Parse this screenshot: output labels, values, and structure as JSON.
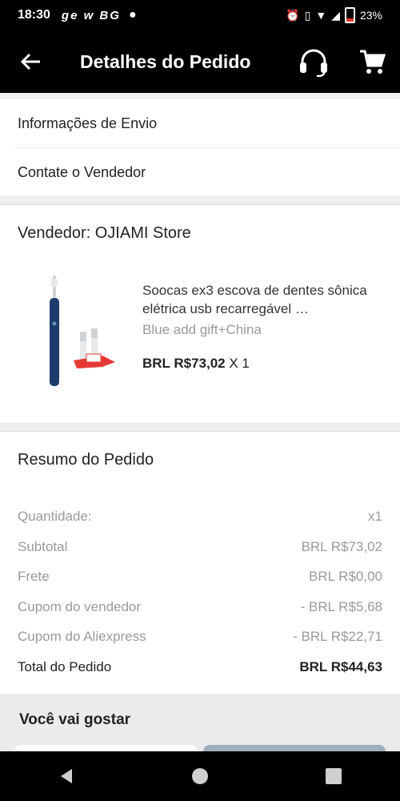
{
  "status_bar": {
    "time": "18:30",
    "apps": "ge w BG",
    "battery": "23%"
  },
  "header": {
    "title": "Detalhes do Pedido",
    "back_icon": "arrow-left-icon",
    "support_icon": "headset-icon",
    "cart_icon": "cart-icon"
  },
  "menu": {
    "items": [
      {
        "label": "Informações de Envio"
      },
      {
        "label": "Contate o Vendedor"
      }
    ]
  },
  "order": {
    "seller": "Vendedor: OJIAMI Store",
    "product": {
      "title": "Soocas ex3 escova de dentes sônica elétrica usb recarregável …",
      "variant": "Blue add gift+China",
      "price": "BRL R$73,02",
      "qty": "X 1"
    }
  },
  "summary": {
    "title": "Resumo do Pedido",
    "rows": [
      {
        "label": "Quantidade:",
        "value": "x1"
      },
      {
        "label": "Subtotal",
        "value": "BRL R$73,02"
      },
      {
        "label": "Frete",
        "value": "BRL R$0,00"
      },
      {
        "label": "Cupom do vendedor",
        "value": "- BRL R$5,68"
      },
      {
        "label": "Cupom do Aliexpress",
        "value": "- BRL R$22,71"
      },
      {
        "label": "Total do Pedido",
        "value": "BRL R$44,63"
      }
    ]
  },
  "recommend": {
    "title": "Você vai gostar"
  },
  "colors": {
    "bar": "#000000",
    "muted": "#9a9a9a",
    "accent_gift": "#e53935"
  }
}
